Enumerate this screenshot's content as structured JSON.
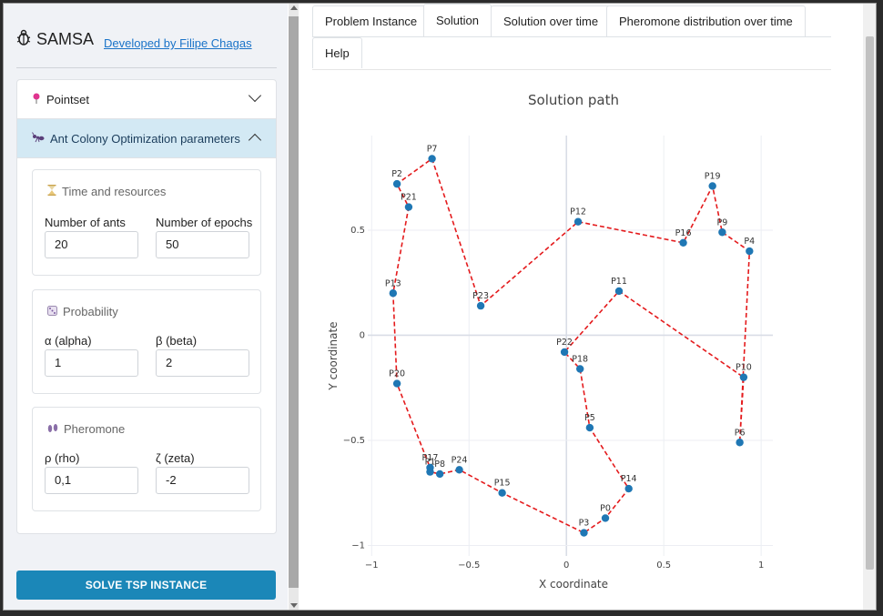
{
  "sidebar": {
    "app_icon": "bug-icon",
    "app_title": "SAMSA",
    "dev_link": "Developed by Filipe Chagas",
    "accordion": {
      "pointset": {
        "label": "Pointset",
        "icon": "pin-icon"
      },
      "aco": {
        "label": "Ant Colony Optimization parameters",
        "icon": "ant-icon"
      }
    },
    "time_card": {
      "title": "Time and resources",
      "icon": "hourglass-icon",
      "ants_label": "Number of ants",
      "ants_value": "20",
      "epochs_label": "Number of epochs",
      "epochs_value": "50"
    },
    "prob_card": {
      "title": "Probability",
      "icon": "dice-icon",
      "alpha_label": "α (alpha)",
      "alpha_value": "1",
      "beta_label": "β (beta)",
      "beta_value": "2"
    },
    "pher_card": {
      "title": "Pheromone",
      "icon": "footprints-icon",
      "rho_label": "ρ (rho)",
      "rho_value": "0,1",
      "zeta_label": "ζ (zeta)",
      "zeta_value": "-2"
    },
    "solve_button": "SOLVE TSP INSTANCE"
  },
  "tabs": [
    "Problem Instance",
    "Solution",
    "Solution over time",
    "Pheromone distribution over time",
    "Help"
  ],
  "active_tab": "Solution",
  "colors": {
    "accent": "#1b87b8",
    "point": "#1f77b4",
    "path": "#e41a1c",
    "active_header": "#d3e9f4"
  },
  "chart_data": {
    "type": "scatter",
    "title": "Solution path",
    "xlabel": "X coordinate",
    "ylabel": "Y coordinate",
    "xlim": [
      -1.02,
      1.06
    ],
    "ylim": [
      -1.05,
      0.95
    ],
    "xticks": [
      {
        "v": -1,
        "t": "−1"
      },
      {
        "v": -0.5,
        "t": "−0.5"
      },
      {
        "v": 0,
        "t": "0"
      },
      {
        "v": 0.5,
        "t": "0.5"
      },
      {
        "v": 1,
        "t": "1"
      }
    ],
    "yticks": [
      {
        "v": -1,
        "t": "−1"
      },
      {
        "v": -0.5,
        "t": "−0.5"
      },
      {
        "v": 0,
        "t": "0"
      },
      {
        "v": 0.5,
        "t": "0.5"
      }
    ],
    "grid": true,
    "points": [
      {
        "name": "P0",
        "x": 0.2,
        "y": -0.87
      },
      {
        "name": "P1",
        "x": -0.7,
        "y": -0.65
      },
      {
        "name": "P2",
        "x": -0.87,
        "y": 0.72
      },
      {
        "name": "P3",
        "x": 0.09,
        "y": -0.94
      },
      {
        "name": "P4",
        "x": 0.94,
        "y": 0.4
      },
      {
        "name": "P5",
        "x": 0.12,
        "y": -0.44
      },
      {
        "name": "P6",
        "x": 0.89,
        "y": -0.51
      },
      {
        "name": "P7",
        "x": -0.69,
        "y": 0.84
      },
      {
        "name": "P8",
        "x": -0.65,
        "y": -0.66
      },
      {
        "name": "P9",
        "x": 0.8,
        "y": 0.49
      },
      {
        "name": "P10",
        "x": 0.91,
        "y": -0.2
      },
      {
        "name": "P11",
        "x": 0.27,
        "y": 0.21
      },
      {
        "name": "P12",
        "x": 0.06,
        "y": 0.54
      },
      {
        "name": "P13",
        "x": -0.89,
        "y": 0.2
      },
      {
        "name": "P14",
        "x": 0.32,
        "y": -0.73
      },
      {
        "name": "P15",
        "x": -0.33,
        "y": -0.75
      },
      {
        "name": "P16",
        "x": 0.6,
        "y": 0.44
      },
      {
        "name": "P17",
        "x": -0.7,
        "y": -0.63
      },
      {
        "name": "P18",
        "x": 0.07,
        "y": -0.16
      },
      {
        "name": "P19",
        "x": 0.75,
        "y": 0.71
      },
      {
        "name": "P20",
        "x": -0.87,
        "y": -0.23
      },
      {
        "name": "P21",
        "x": -0.81,
        "y": 0.61
      },
      {
        "name": "P22",
        "x": -0.01,
        "y": -0.08
      },
      {
        "name": "P23",
        "x": -0.44,
        "y": 0.14
      },
      {
        "name": "P24",
        "x": -0.55,
        "y": -0.64
      }
    ],
    "tour": [
      "P7",
      "P23",
      "P12",
      "P16",
      "P19",
      "P9",
      "P4",
      "P6",
      "P10",
      "P11",
      "P22",
      "P18",
      "P5",
      "P14",
      "P0",
      "P3",
      "P15",
      "P24",
      "P8",
      "P1",
      "P17",
      "P20",
      "P13",
      "P21",
      "P2",
      "P7"
    ]
  }
}
